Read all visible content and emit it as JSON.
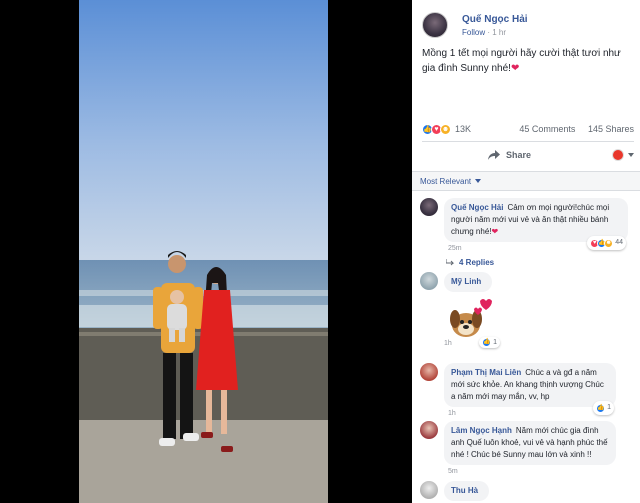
{
  "post": {
    "author": "Quế Ngọc Hải",
    "follow": "Follow",
    "time": "1 hr",
    "caption": "Mồng 1 tết mọi người hãy cười thật tươi như gia đình Sunny nhé!",
    "caption_emoji": "❤",
    "reaction_count": "13K",
    "comments_count": "45 Comments",
    "shares_count": "145 Shares",
    "share_label": "Share",
    "sort_label": "Most Relevant"
  },
  "comments": [
    {
      "name": "Quế Ngọc Hải",
      "text": "Cảm ơn mọi người!chúc mọi người năm mới vui vẻ và ăn thật nhiều bánh chưng nhé!",
      "emoji": "❤",
      "time": "25m",
      "reactions": "44",
      "replies": "4 Replies"
    },
    {
      "name": "Mỹ Linh",
      "text": "",
      "time": "1h",
      "reactions": "1"
    },
    {
      "name": "Phạm Thị Mai Liên",
      "text": "Chúc a và gđ a năm mới sức khỏe. An khang thịnh vượng Chúc a năm mới may mắn, vv, hp",
      "time": "1h",
      "reactions": "1"
    },
    {
      "name": "Lâm Ngọc Hạnh",
      "text": "Năm mới chúc gia đình anh Quế luôn khoẻ, vui vẻ và hạnh phúc thế nhé ! Chúc bé Sunny mau lớn và xinh !!",
      "time": "5m"
    },
    {
      "name": "Thu Hà"
    }
  ],
  "icons": {
    "share": "share-icon",
    "reply": "reply-arrow-icon",
    "like": "like-reaction-icon",
    "love": "love-reaction-icon",
    "haha": "haha-reaction-icon",
    "sticker": "dog-sticker"
  },
  "colors": {
    "link": "#385898",
    "like": "#1877f2",
    "love": "#f33e58",
    "haha": "#f7b125"
  }
}
